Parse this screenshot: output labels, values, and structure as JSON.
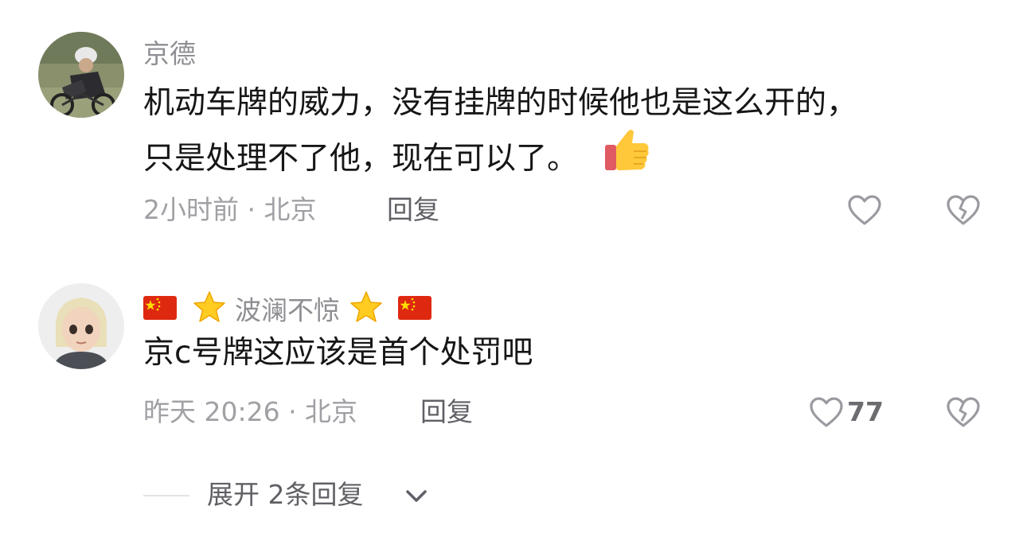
{
  "comments": [
    {
      "username": "京德",
      "text_line1": "机动车牌的威力，没有挂牌的时候他也是这么开的，",
      "text_line2": "只是处理不了他，现在可以了。",
      "emoji": "thumbs-up",
      "time_location": "2小时前 · 北京",
      "reply_label": "回复",
      "like_count": ""
    },
    {
      "username": "波澜不惊",
      "username_decorations": [
        "cn-flag",
        "star",
        "star",
        "cn-flag"
      ],
      "text_line1": "京c号牌这应该是首个处罚吧",
      "time_location": "昨天 20:26 · 北京",
      "reply_label": "回复",
      "like_count": "77"
    }
  ],
  "expand": {
    "label": "展开 2条回复"
  },
  "icons": {
    "like": "heart-outline-icon",
    "dislike": "broken-heart-outline-icon",
    "chevron": "chevron-down-icon"
  },
  "colors": {
    "username": "#8e8e93",
    "meta": "#a0a0a5",
    "icon": "#9a9aa0",
    "flag_red": "#de2910",
    "flag_star": "#ffde00",
    "star": "#ffcc22"
  }
}
